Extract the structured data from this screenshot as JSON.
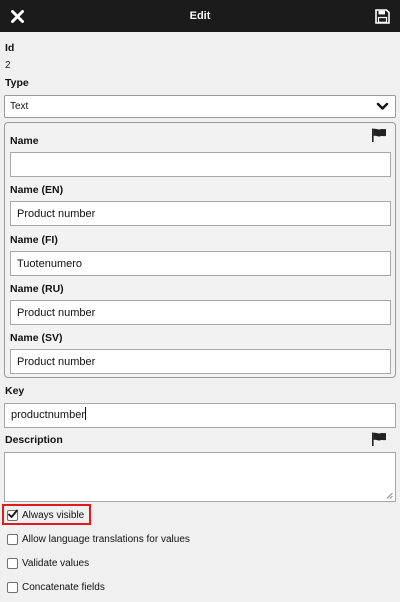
{
  "header": {
    "title": "Edit",
    "close_icon": "close-icon",
    "save_icon": "save-icon"
  },
  "fields": {
    "id": {
      "label": "Id",
      "value": "2"
    },
    "type": {
      "label": "Type",
      "selected": "Text"
    },
    "name": {
      "label": "Name",
      "value": ""
    },
    "name_en": {
      "label": "Name (EN)",
      "value": "Product number"
    },
    "name_fi": {
      "label": "Name (FI)",
      "value": "Tuotenumero"
    },
    "name_ru": {
      "label": "Name (RU)",
      "value": "Product number"
    },
    "name_sv": {
      "label": "Name (SV)",
      "value": "Product number"
    },
    "key": {
      "label": "Key",
      "value": "productnumber"
    },
    "description": {
      "label": "Description",
      "value": ""
    }
  },
  "options": {
    "always_visible": {
      "label": "Always visible",
      "checked": true
    },
    "allow_language_translations": {
      "label": "Allow language translations for values",
      "checked": false
    },
    "validate_values": {
      "label": "Validate values",
      "checked": false
    },
    "concatenate_fields": {
      "label": "Concatenate fields",
      "checked": false
    }
  },
  "colors": {
    "topbar": "#1b1b1b",
    "background": "#f0f0f0",
    "highlight": "#e01b1b"
  }
}
